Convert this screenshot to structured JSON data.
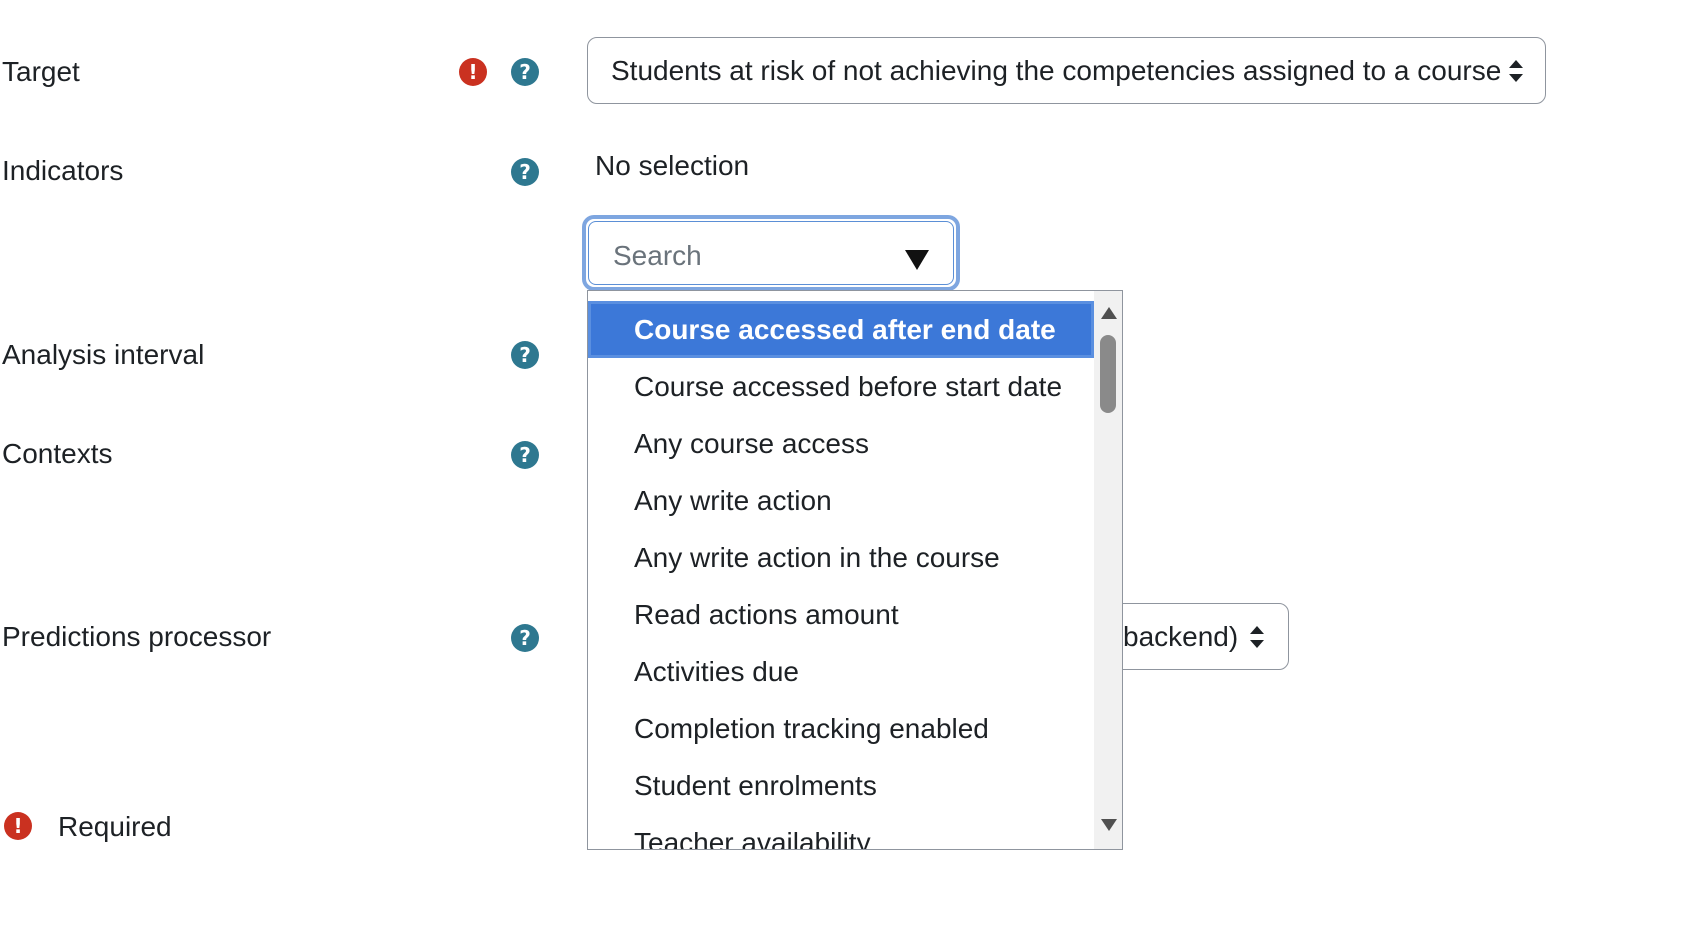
{
  "fields": {
    "target": {
      "label": "Target",
      "value": "Students at risk of not achieving the competencies assigned to a course"
    },
    "indicators": {
      "label": "Indicators",
      "selection_text": "No selection",
      "search_placeholder": "Search",
      "options": [
        "Course accessed after end date",
        "Course accessed before start date",
        "Any course access",
        "Any write action",
        "Any write action in the course",
        "Read actions amount",
        "Activities due",
        "Completion tracking enabled",
        "Student enrolments",
        "Teacher availability"
      ],
      "highlighted_option": "Course accessed after end date"
    },
    "analysis_interval": {
      "label": "Analysis interval"
    },
    "contexts": {
      "label": "Contexts"
    },
    "predictions_processor": {
      "label": "Predictions processor",
      "value_visible": "backend)"
    }
  },
  "footer": {
    "required_label": "Required"
  },
  "icons": {
    "help": "question-circle-icon",
    "required": "exclamation-circle-icon"
  },
  "colors": {
    "help_icon": "#2e7890",
    "required_icon": "#ca3120",
    "highlight": "#3c78d8",
    "focus_ring": "#7ea6e0"
  }
}
